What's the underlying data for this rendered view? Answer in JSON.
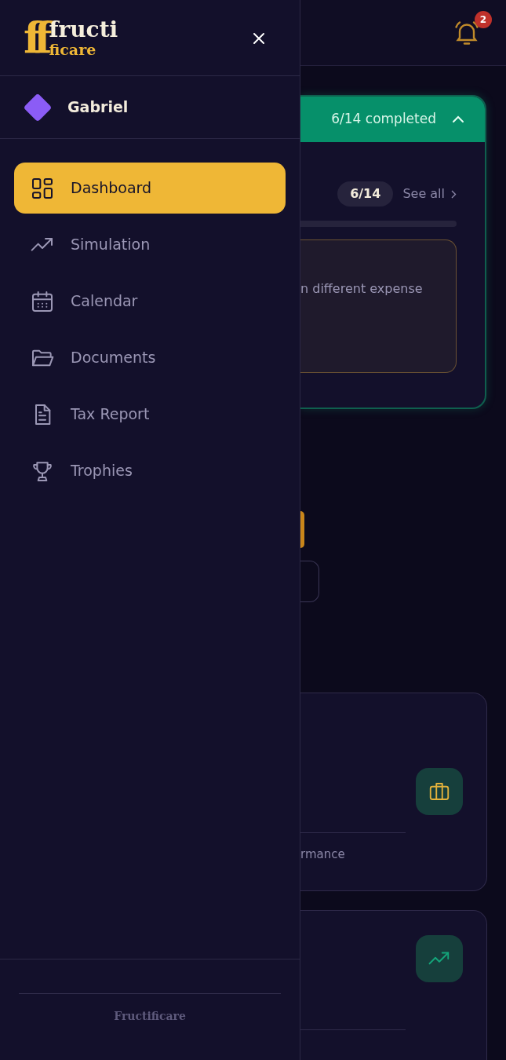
{
  "sidebar": {
    "logo": {
      "mark": "ff",
      "line1": "fructi",
      "line2": "ficare"
    },
    "user": {
      "name": "Gabriel"
    },
    "items": [
      {
        "label": "Dashboard",
        "selected": true
      },
      {
        "label": "Simulation",
        "selected": false
      },
      {
        "label": "Calendar",
        "selected": false
      },
      {
        "label": "Documents",
        "selected": false
      },
      {
        "label": "Tax Report",
        "selected": false
      },
      {
        "label": "Trophies",
        "selected": false
      }
    ],
    "footer": "Fructificare"
  },
  "header": {
    "notifications": "2"
  },
  "progress_card": {
    "status": "6/14 completed",
    "count": "6/14",
    "see_all": "See all",
    "tip_fragment": "n different expense"
  },
  "cards": [
    {
      "text_fragment": "rmance"
    }
  ]
}
